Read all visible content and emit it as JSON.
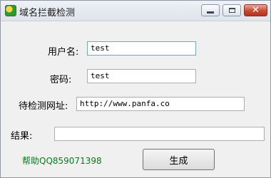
{
  "window": {
    "title": "域名拦截检测",
    "close_symbol": "✕"
  },
  "form": {
    "username_label": "用户名:",
    "username_value": "test",
    "password_label": "密码:",
    "password_value": "test",
    "url_label": "待检测网址:",
    "url_value": "http://www.panfa.co",
    "result_label": "结果:",
    "result_value": ""
  },
  "footer": {
    "help_text": "帮助QQ859071398",
    "generate_label": "生成"
  },
  "colors": {
    "help_text": "#0a7a1a",
    "close_button": "#c74a34"
  }
}
